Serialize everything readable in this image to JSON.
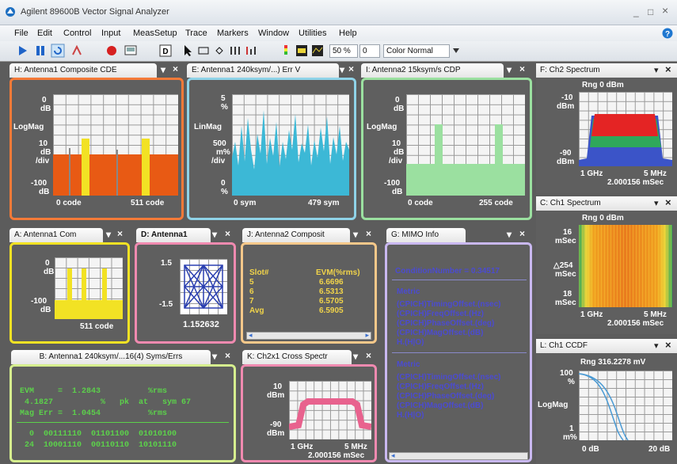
{
  "window": {
    "title": "Agilent 89600B Vector Signal Analyzer",
    "min": "_",
    "max": "□",
    "close": "×"
  },
  "menu": [
    "File",
    "Edit",
    "Control",
    "Input",
    "MeasSetup",
    "Trace",
    "Markers",
    "Window",
    "Utilities",
    "Help"
  ],
  "toolbar": {
    "zoom": "50 %",
    "offset": "0",
    "color_mode": "Color Normal"
  },
  "panels": {
    "H": {
      "tab": "H: Antenna1 Composite CDE",
      "y_top": "0",
      "y_top_unit": "dB",
      "scale": "LogMag",
      "div": "10",
      "div_unit1": "dB",
      "div_unit2": "/div",
      "y_bot": "-100",
      "y_bot_unit": "dB",
      "x_left": "0  code",
      "x_right": "511  code"
    },
    "E": {
      "tab": "E: Antenna1 240ksym/...) Err V",
      "y_top": "5",
      "y_top_unit": "%",
      "scale": "LinMag",
      "div": "500",
      "div_unit1": "m%",
      "div_unit2": "/div",
      "y_bot": "0",
      "y_bot_unit": "%",
      "x_left": "0  sym",
      "x_right": "479  sym"
    },
    "I": {
      "tab": "I: Antenna2 15ksym/s CDP",
      "y_top": "0",
      "y_top_unit": "dB",
      "scale": "LogMag",
      "div": "10",
      "div_unit1": "dB",
      "div_unit2": "/div",
      "y_bot": "-100",
      "y_bot_unit": "dB",
      "x_left": "0  code",
      "x_right": "255  code"
    },
    "A": {
      "tab": "A: Antenna1 Com",
      "y_top": "0",
      "y_top_unit": "dB",
      "y_bot": "-100",
      "y_bot_unit": "dB",
      "x_right": "511  code"
    },
    "D": {
      "tab": "D: Antenna1",
      "y_top": "1.5",
      "y_bot": "-1.5",
      "readout": "1.152632"
    },
    "J": {
      "tab": "J: Antenna2 Composit",
      "col1": "Slot#",
      "col2": "EVM(%rms)",
      "rows": [
        [
          "5",
          "6.6696"
        ],
        [
          "6",
          "6.5313"
        ],
        [
          "7",
          "6.5705"
        ],
        [
          "Avg",
          "6.5905"
        ]
      ]
    },
    "G": {
      "tab": "G: MIMO Info",
      "condition": "ConditionNumber =  0.34517",
      "metric_label": "Metric",
      "metrics1": [
        "(CPICH)TimingOffset.(nsec)",
        "(CPICH)FreqOffset.(Hz)",
        "(CPICH)PhaseOffset.(deg)",
        "(CPICH)MagOffset.(dB)",
        "H.(H|O)"
      ],
      "metric_label2": "Metric",
      "metrics2": [
        "(CPICH)TimingOffset.(nsec)",
        "(CPICH)FreqOffset.(Hz)",
        "(CPICH)PhaseOffset.(deg)",
        "(CPICH)MagOffset.(dB)",
        "H.(H|O)"
      ]
    },
    "B": {
      "tab": "B: Antenna1 240ksym/...16(4) Syms/Errs",
      "evm": "EVM     =  1.2843          %rms",
      "pk": " 4.1827          %   pk  at   sym 67",
      "mag": "Mag Err =  1.0454          %rms",
      "bits1": "  0  00111110  01101100  01010100",
      "bits2": " 24  10001110  00110110  10101110"
    },
    "K": {
      "tab": "K: Ch2x1 Cross Spectr",
      "y_top": "10",
      "y_top_unit": "dBm",
      "y_bot": "-90",
      "y_bot_unit": "dBm",
      "x_left": "1 GHz",
      "x_right": "5 MHz",
      "time": "2.000156 mSec"
    },
    "F": {
      "tab": "F: Ch2 Spectrum",
      "rng": "Rng 0 dBm",
      "y_top": "-10",
      "y_top_unit": "dBm",
      "y_bot": "-90",
      "y_bot_unit": "dBm",
      "x_left": "1 GHz",
      "x_right": "5 MHz",
      "time": "2.000156 mSec"
    },
    "C": {
      "tab": "C: Ch1 Spectrum",
      "rng": "Rng 0 dBm",
      "y_top": "16",
      "y_top_unit": "mSec",
      "y_mid": "△254",
      "y_mid_unit": "mSec",
      "y_bot": "18",
      "y_bot_unit": "mSec",
      "x_left": "1 GHz",
      "x_right": "5 MHz",
      "time": "2.000156 mSec"
    },
    "L": {
      "tab": "L: Ch1 CCDF",
      "rng": "Rng 316.2278 mV",
      "y_top": "100",
      "y_top_unit": "%",
      "scale": "LogMag",
      "y_bot": "1",
      "y_bot_unit": "m%",
      "x_left": "0 dB",
      "x_right": "20 dB"
    }
  },
  "colors": {
    "orange": "#f47a38",
    "cyan": "#8fd3e8",
    "green": "#9be0a0",
    "yellow": "#f2e224",
    "pink": "#f08ab0",
    "lavender": "#c9b8f0",
    "lime": "#d6ef8e",
    "peach": "#f6c88a"
  }
}
